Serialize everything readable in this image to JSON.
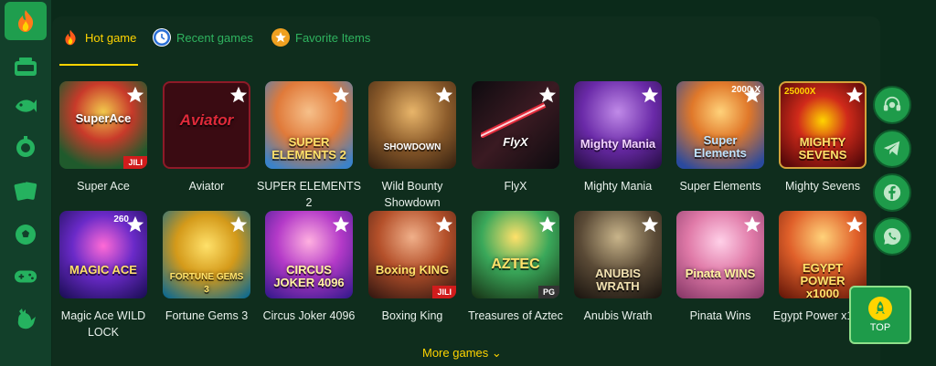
{
  "sidebar": {
    "items": [
      {
        "icon": "flame-icon"
      },
      {
        "icon": "slot-machine-icon"
      },
      {
        "icon": "fish-icon"
      },
      {
        "icon": "roulette-icon"
      },
      {
        "icon": "cards-icon"
      },
      {
        "icon": "soccer-ball-icon"
      },
      {
        "icon": "gamepad-icon"
      },
      {
        "icon": "rooster-icon"
      }
    ]
  },
  "tabs": [
    {
      "label": "Hot game",
      "icon": "flame-icon",
      "color": "#ffd400"
    },
    {
      "label": "Recent games",
      "icon": "clock-icon",
      "color": "#2fb35f"
    },
    {
      "label": "Favorite Items",
      "icon": "star-icon",
      "color": "#2fb35f"
    }
  ],
  "games": [
    {
      "name": "Super Ace",
      "thumb_text": "SuperAce",
      "badge": "JILI",
      "bg": "#1f5a2c"
    },
    {
      "name": "Aviator",
      "thumb_text": "Aviator",
      "bg": "#5a0d14"
    },
    {
      "name": "SUPER ELEMENTS 2",
      "thumb_text": "SUPER ELEMENTS 2",
      "bg": "#d4662b"
    },
    {
      "name": "Wild Bounty Showdown",
      "thumb_text": "SHOWDOWN",
      "bg": "#6b4423"
    },
    {
      "name": "FlyX",
      "thumb_text": "FlyX",
      "bg": "#1a1015"
    },
    {
      "name": "Mighty Mania",
      "thumb_text": "Mighty Mania",
      "bg": "#4a2a6b"
    },
    {
      "name": "Super Elements",
      "thumb_text": "Super Elements",
      "corner": "2000 X",
      "bg": "#2a4a9e"
    },
    {
      "name": "Mighty Sevens",
      "thumb_text": "MIGHTY SEVENS",
      "corner": "25000X",
      "bg": "#8e1414"
    },
    {
      "name": "Magic Ace WILD LOCK",
      "thumb_text": "MAGIC ACE",
      "corner": "260",
      "bg": "#3a1e7a"
    },
    {
      "name": "Fortune Gems 3",
      "thumb_text": "FORTUNE GEMS 3",
      "bg": "#b07a16"
    },
    {
      "name": "Circus Joker 4096",
      "thumb_text": "CIRCUS JOKER 4096",
      "bg": "#7e2c8e"
    },
    {
      "name": "Boxing King",
      "thumb_text": "Boxing KING",
      "badge": "JILI",
      "bg": "#8e3a1e"
    },
    {
      "name": "Treasures of Aztec",
      "thumb_text": "AZTEC",
      "badge": "PG",
      "bg": "#3e6b2c"
    },
    {
      "name": "Anubis Wrath",
      "thumb_text": "ANUBIS WRATH",
      "bg": "#4a4036"
    },
    {
      "name": "Pinata Wins",
      "thumb_text": "Pinata WINS",
      "bg": "#c85a8e"
    },
    {
      "name": "Egypt Power x1000",
      "thumb_text": "EGYPT POWER x1000",
      "bg": "#c04a14"
    }
  ],
  "more_label": "More games ⌄",
  "social": [
    {
      "icon": "customer-service-icon"
    },
    {
      "icon": "telegram-icon"
    },
    {
      "icon": "facebook-icon"
    },
    {
      "icon": "whatsapp-icon"
    }
  ],
  "top_label": "TOP"
}
